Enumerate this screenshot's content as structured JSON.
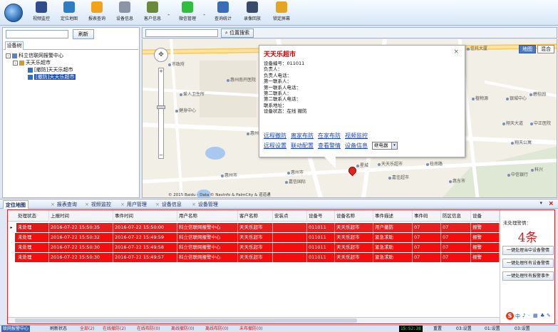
{
  "colors": {
    "alarm_red": "#f40d0d",
    "unhandled_red": "#e21818",
    "link_blue": "#1a44c7",
    "count_red": "#d21d1d"
  },
  "toolbar": {
    "items": [
      {
        "label": "视频监控",
        "icon": "camera-icon",
        "color": "#2e4d8a"
      },
      {
        "label": "定位地图",
        "icon": "globe-icon",
        "color": "#2f7cc6"
      },
      {
        "label": "报表查询",
        "icon": "warning-icon",
        "color": "#f2a11a"
      },
      {
        "label": "设备信息",
        "icon": "device-icon",
        "color": "#8b95a6"
      },
      {
        "label": "客户信息",
        "icon": "people-icon",
        "color": "#6a8a3a"
      },
      {
        "label": "微信管理",
        "icon": "wechat-icon",
        "color": "#2fbf3c"
      },
      {
        "label": "查询统计",
        "icon": "stats-icon",
        "color": "#3a6db7"
      },
      {
        "label": "录像回放",
        "icon": "film-icon",
        "color": "#3a4a6a"
      },
      {
        "label": "锁定屏幕",
        "icon": "lock-icon",
        "color": "#e3a622"
      }
    ],
    "separator": "-"
  },
  "left_panel": {
    "refresh_label": "刷新",
    "tab_label": "设备树",
    "tree": [
      {
        "label": "科立信联网报警中心",
        "indent": 0,
        "box": "-",
        "selected": false
      },
      {
        "label": "天天乐超市",
        "indent": 1,
        "box": "-",
        "selected": false
      },
      {
        "label": "[撤防]天天乐超市",
        "indent": 2,
        "box": "",
        "selected": false
      },
      {
        "label": "[撤防]天天乐超市",
        "indent": 2,
        "box": "",
        "selected": true
      }
    ]
  },
  "map": {
    "locate_label": "位置搜索",
    "map_types": [
      "地图",
      "混合"
    ],
    "labels": [
      {
        "text": "市政府",
        "style": "left:36px;top:30px;"
      },
      {
        "text": "爱人卫生所",
        "style": "left:52px;top:72px;"
      },
      {
        "text": "惠州南开医院",
        "style": "left:118px;top:52px;"
      },
      {
        "text": "健身中心",
        "style": "left:46px;top:95px;"
      },
      {
        "text": "惠州市",
        "style": "left:110px;top:186px;"
      },
      {
        "text": "惠州市",
        "style": "left:203px;top:182px;"
      },
      {
        "text": "惠州第一",
        "style": "left:146px;top:127px;"
      },
      {
        "text": "嘉信国际",
        "style": "left:200px;top:195px;"
      },
      {
        "text": "大路小超市",
        "style": "left:300px;top:147px;"
      },
      {
        "text": "伊金",
        "style": "left:290px;top:135px;"
      },
      {
        "text": "星城",
        "style": "left:300px;top:172px;"
      },
      {
        "text": "天天乐超市",
        "style": "left:330px;top:170px;"
      },
      {
        "text": "嘉佳超市",
        "style": "left:345px;top:189px;"
      },
      {
        "text": "惠东市",
        "style": "left:430px;top:194px;"
      },
      {
        "text": "中信银行",
        "style": "left:512px;top:185px;"
      },
      {
        "text": "桂南路",
        "style": "left:398px;top:170px;"
      },
      {
        "text": "植物源",
        "style": "left:462px;top:78px;"
      },
      {
        "text": "银城中心",
        "style": "left:510px;top:78px;"
      },
      {
        "text": "碧桂园",
        "style": "left:543px;top:72px;"
      },
      {
        "text": "信托大厦",
        "style": "left:455px;top:8px;"
      },
      {
        "text": "翔天公寓",
        "style": "left:517px;top:140px;"
      },
      {
        "text": "翔天大道",
        "style": "left:505px;top:113px;"
      },
      {
        "text": "中正医院",
        "style": "left:544px;top:113px;"
      },
      {
        "text": "科兴",
        "style": "left:545px;top:178px;"
      }
    ],
    "copyright": "© 2015 Baidu - Data © NavInfo & PalmCity & 道道通"
  },
  "popup": {
    "title": "天天乐超市",
    "close": "×",
    "fields": [
      "设备编号：011011",
      "负责人：",
      "负责人电话：",
      "第一联系人：",
      "第一联系人电话：",
      "第二联系人：",
      "第二联系人电话：",
      "联系地址：",
      "设备状态：在线  撤防"
    ],
    "links_row1": [
      "远程撤防",
      "离家布防",
      "在家布防",
      "视频监控"
    ],
    "links_row2": [
      "远程设置",
      "联动配置",
      "查看警情",
      "设备信息"
    ],
    "select_value": "继电器"
  },
  "lower_tabs": [
    {
      "label": "定位地图",
      "active": true
    },
    {
      "label": "报表查询",
      "active": false
    },
    {
      "label": "视频监控",
      "active": false
    },
    {
      "label": "用户管理",
      "active": false
    },
    {
      "label": "设备信息",
      "active": false
    },
    {
      "label": "设备管理",
      "active": false
    }
  ],
  "lower_tab_close": "×",
  "lower_tab_pin": "▾",
  "alarm_table": {
    "columns": [
      "处理状态",
      "上报时间",
      "事件时间",
      "用户名称",
      "客户名称",
      "安装点",
      "设备号",
      "设备名称",
      "事件描述",
      "事件码",
      "防区信息",
      "设备"
    ],
    "rows": [
      [
        "未处理",
        "2016-07-22 15:50:35",
        "2016-07-22 15:50:00",
        "科立信联网报警中心",
        "天天乐超市",
        "",
        "011011",
        "天天乐超市",
        "用户撤防",
        "07",
        "07",
        "报警"
      ],
      [
        "未处理",
        "2016-07-22 15:50:32",
        "2016-07-22 15:49:59",
        "科立信联网报警中心",
        "天天乐超市",
        "",
        "011011",
        "天天乐超市",
        "紧急求助",
        "07",
        "07",
        "报警"
      ],
      [
        "未处理",
        "2016-07-22 15:50:30",
        "2016-07-22 15:49:58",
        "科立信联网报警中心",
        "天天乐超市",
        "",
        "011011",
        "天天乐超市",
        "紧急求助",
        "07",
        "07",
        "报警"
      ],
      [
        "未处理",
        "2016-07-22 15:50:30",
        "2016-07-22 15:49:57",
        "科立信联网报警中心",
        "天天乐超市",
        "",
        "011011",
        "天天乐超市",
        "紧急求助",
        "07",
        "07",
        "报警"
      ]
    ]
  },
  "side_panel": {
    "label": "未处理警情：",
    "count": "4条",
    "buttons": [
      "一键处理当中设备警情",
      "一键处理所有设备警情",
      "一键处理所有报警事件"
    ]
  },
  "status_bar": {
    "items": [
      {
        "text": "联网报警中心",
        "style": "blue"
      },
      {
        "text": "刷新状态",
        "style": "plain"
      },
      {
        "text": "全部(2)",
        "style": "red"
      },
      {
        "text": "在线撤防(2)",
        "style": "red"
      },
      {
        "text": "在线布防(0)",
        "style": "red"
      },
      {
        "text": "离线撤防(0)",
        "style": "red"
      },
      {
        "text": "离线布防(0)",
        "style": "red"
      },
      {
        "text": "未布撤防(0)",
        "style": "red"
      }
    ],
    "clock": "15:52:38",
    "right_items": [
      "重置",
      "03:设置",
      "01:设置",
      "03:设置"
    ]
  }
}
